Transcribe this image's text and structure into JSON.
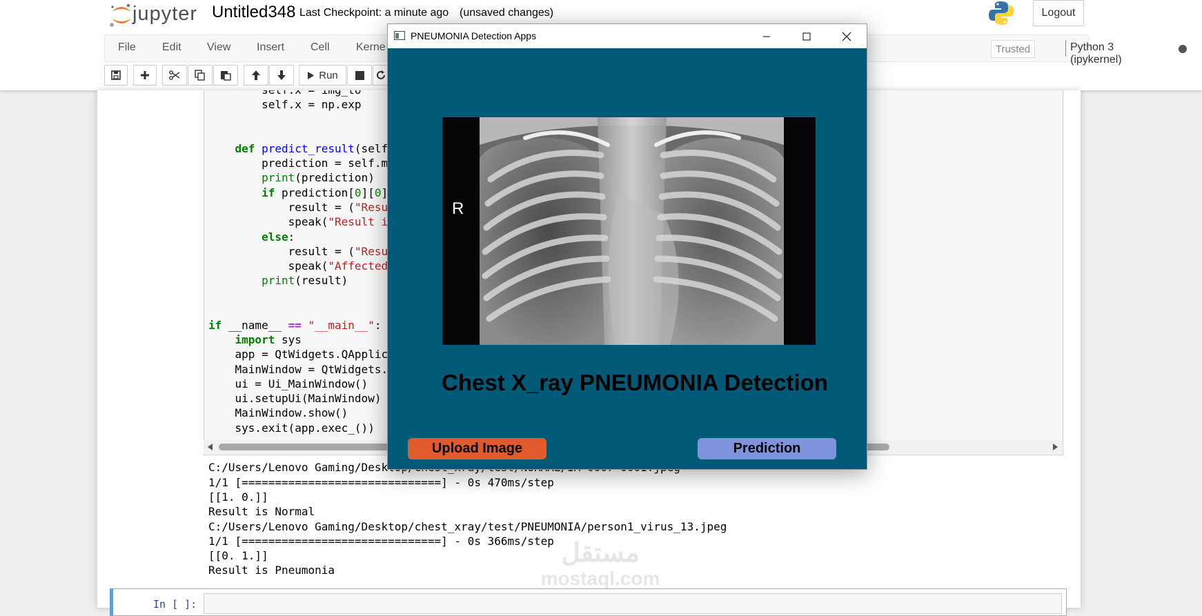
{
  "header": {
    "logo_text": "jupyter",
    "notebook_title": "Untitled348",
    "checkpoint": "Last Checkpoint: a minute ago",
    "unsaved": "(unsaved changes)",
    "logout_label": "Logout"
  },
  "menubar": {
    "items": [
      "File",
      "Edit",
      "View",
      "Insert",
      "Cell",
      "Kerne"
    ],
    "trusted": "Trusted",
    "kernel": "Python 3 (ipykernel)"
  },
  "toolbar": {
    "run_label": "Run",
    "icons": [
      "save-icon",
      "plus-icon",
      "scissors-icon",
      "copy-icon",
      "paste-icon",
      "arrow-up-icon",
      "arrow-down-icon",
      "play-icon",
      "stop-icon",
      "restart-icon"
    ]
  },
  "code": {
    "lines": [
      "        self.x = img_to",
      "        self.x = np.exp",
      "",
      "",
      "    def predict_result(self",
      "        prediction = self.m",
      "        print(prediction)",
      "        if prediction[0][0]",
      "            result = (\"Resu",
      "            speak(\"Result i",
      "        else:",
      "            result = (\"Resu",
      "            speak(\"Affected",
      "        print(result)",
      "",
      "",
      "if __name__ == \"__main__\":",
      "    import sys",
      "    app = QtWidgets.QApplic",
      "    MainWindow = QtWidgets.",
      "    ui = Ui_MainWindow()",
      "    ui.setupUi(MainWindow)",
      "    MainWindow.show()",
      "    sys.exit(app.exec_())"
    ]
  },
  "output": {
    "lines": [
      "C:/Users/Lenovo Gaming/Desktop/chest_xray/test/NORMAL/IM-0007-0001.jpeg",
      "1/1 [==============================] - 0s 470ms/step",
      "[[1. 0.]]",
      "Result is Normal",
      "C:/Users/Lenovo Gaming/Desktop/chest_xray/test/PNEUMONIA/person1_virus_13.jpeg",
      "1/1 [==============================] - 0s 366ms/step",
      "[[0. 1.]]",
      "Result is Pneumonia"
    ]
  },
  "next_cell": {
    "prompt": "In [ ]:"
  },
  "app_window": {
    "title": "PNEUMONIA Detection Apps",
    "xray_marker": "R",
    "heading": "Chest X_ray PNEUMONIA Detection",
    "upload_label": "Upload Image",
    "predict_label": "Prediction",
    "colors": {
      "background": "#005a78",
      "upload_button": "#e05a2b",
      "predict_button": "#7f93dc"
    }
  },
  "watermark": {
    "arabic": "مستقل",
    "latin": "mostaql.com"
  }
}
